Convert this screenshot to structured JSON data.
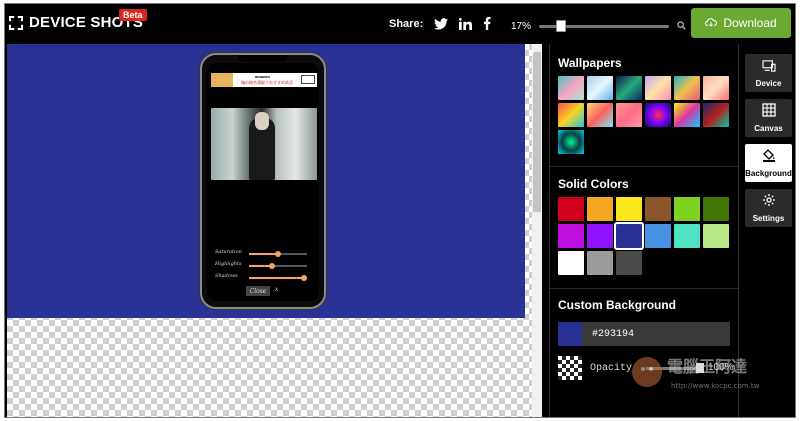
{
  "header": {
    "app_title": "DEVICE SHOTS",
    "beta_badge": "Beta",
    "share_label": "Share:",
    "share_icons": [
      "twitter-icon",
      "linkedin-icon",
      "facebook-icon"
    ],
    "zoom_value": "17%",
    "zoom_level": 0.17,
    "download_label": "Download"
  },
  "canvas": {
    "background_color": "#293194"
  },
  "phone_screen": {
    "ad_brand": "amazon",
    "ad_text": "箱の総合通販でおすすめ商品",
    "ad_button": "今すぐ購入",
    "sliders": [
      {
        "label": "Saturation",
        "level": 0.5
      },
      {
        "label": "Highlights",
        "level": 0.4
      },
      {
        "label": "Shadows",
        "level": 0.95
      }
    ],
    "close_label": "Close",
    "close_x": "x"
  },
  "panel": {
    "wallpapers_title": "Wallpapers",
    "wallpapers": [
      "linear-gradient(135deg,#3fc1c9,#f7a6c1,#a8e6cf)",
      "linear-gradient(135deg,#9fd3f0,#eaf6ff,#5fb0e6)",
      "linear-gradient(135deg,#0d1b4c,#28a97a,#0a2a6b)",
      "linear-gradient(135deg,#c9a5f7,#fbe3a8,#ff8fb3)",
      "linear-gradient(135deg,#16b4c6,#f2c14e,#e75a7c)",
      "linear-gradient(135deg,#ffb199,#ffe0c8,#ff6b6b)",
      "linear-gradient(135deg,#ff4e50,#f9d423,#24c6dc)",
      "linear-gradient(135deg,#ffd86f,#fc6262,#7ee8fa)",
      "linear-gradient(135deg,#ff9a8b,#ff6a88,#ff99ac)",
      "radial-gradient(circle,#ff2d55,#7a00ff,#001a4d)",
      "linear-gradient(135deg,#f7ff00,#db36a4,#00d2ff)",
      "linear-gradient(135deg,#1a2a6c,#b21f1f,#00c9a7)",
      "radial-gradient(circle,#00f5a0,#0a3d3d,#00d9f5)"
    ],
    "solid_title": "Solid Colors",
    "solid_colors": [
      "#d0021b",
      "#f5a623",
      "#f8e71c",
      "#8b572a",
      "#7ed321",
      "#417505",
      "#bd10e0",
      "#9013fe",
      "#293194",
      "#4a90e2",
      "#50e3c2",
      "#b8e986",
      "#ffffff",
      "#9b9b9b",
      "#4a4a4a"
    ],
    "selected_color_index": 8,
    "custom_title": "Custom Background",
    "custom_hex": "#293194",
    "opacity_label": "Opacity",
    "opacity_value": "100%",
    "opacity_level": 1.0
  },
  "rail": {
    "tools": [
      {
        "label": "Device",
        "icon": "device-icon",
        "active": false
      },
      {
        "label": "Canvas",
        "icon": "canvas-grid-icon",
        "active": false
      },
      {
        "label": "Background",
        "icon": "paint-bucket-icon",
        "active": true
      },
      {
        "label": "Settings",
        "icon": "gear-icon",
        "active": false
      }
    ]
  },
  "watermark": {
    "text": "電腦王阿達",
    "url": "http://www.kocpc.com.tw"
  }
}
